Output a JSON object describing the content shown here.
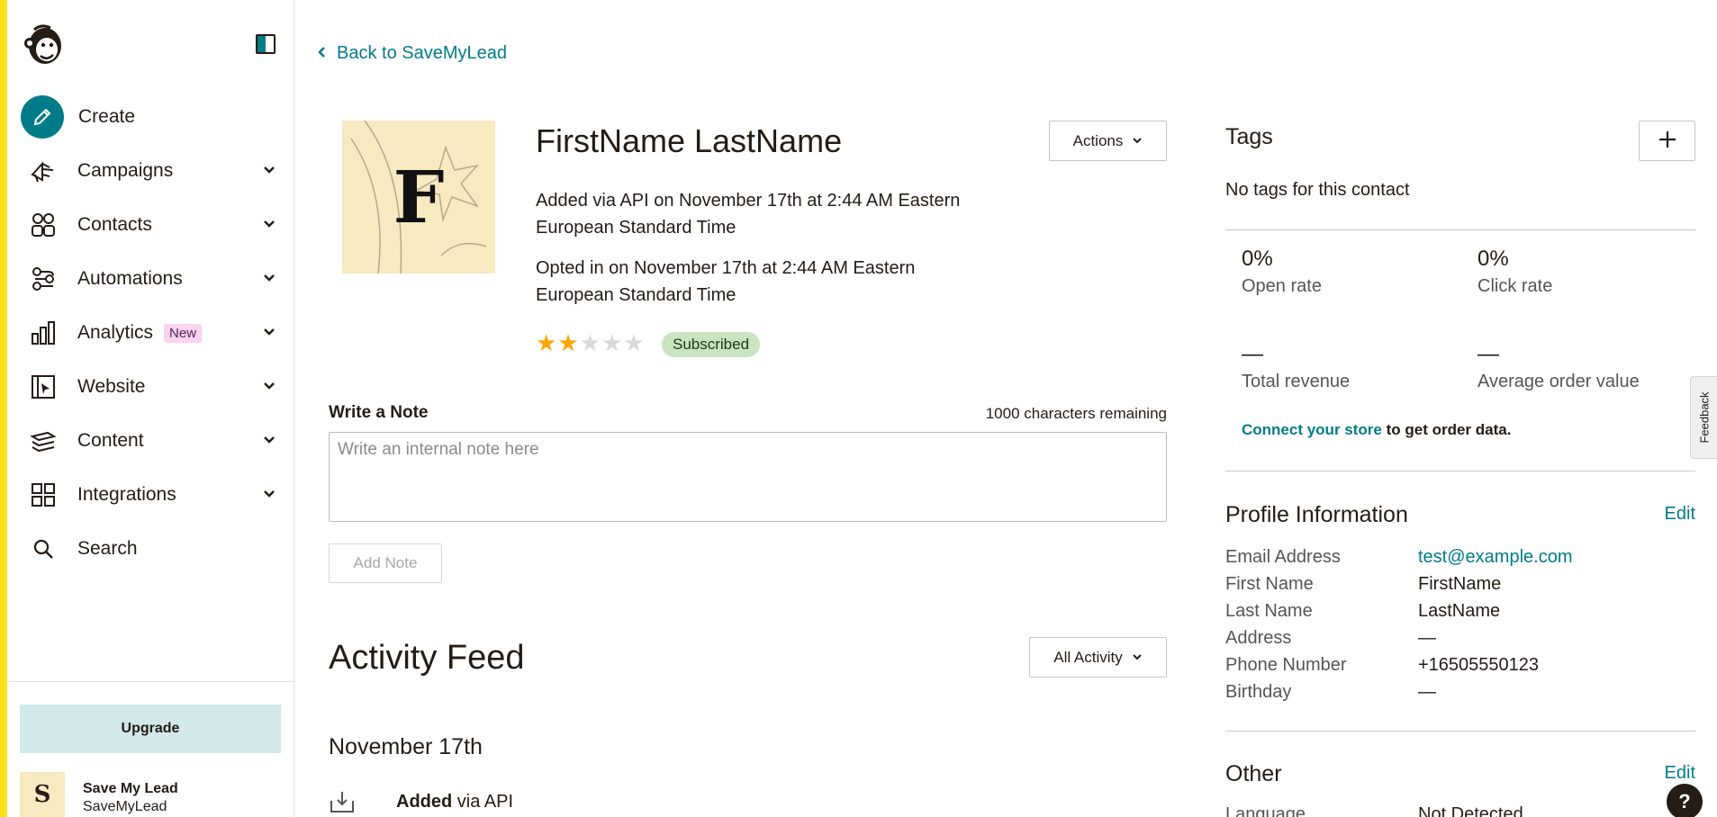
{
  "sidebar": {
    "create_label": "Create",
    "items": [
      {
        "label": "Campaigns",
        "icon": "megaphone-icon"
      },
      {
        "label": "Contacts",
        "icon": "contacts-icon"
      },
      {
        "label": "Automations",
        "icon": "automation-icon"
      },
      {
        "label": "Analytics",
        "icon": "bar-chart-icon",
        "badge": "New"
      },
      {
        "label": "Website",
        "icon": "website-icon"
      },
      {
        "label": "Content",
        "icon": "content-icon"
      },
      {
        "label": "Integrations",
        "icon": "grid-icon"
      },
      {
        "label": "Search",
        "icon": "search-icon"
      }
    ],
    "upgrade_label": "Upgrade",
    "account": {
      "avatar_letter": "S",
      "name": "Save My Lead",
      "org": "SaveMyLead"
    }
  },
  "main": {
    "back_link": "Back to SaveMyLead",
    "contact": {
      "avatar_letter": "F",
      "name": "FirstName LastName",
      "added_line1": "Added via API on November 17th at 2:44 AM Eastern",
      "added_line2": "European Standard Time",
      "opted_line1": "Opted in on November 17th at 2:44 AM Eastern",
      "opted_line2": "European Standard Time",
      "rating": 2,
      "rating_max": 5,
      "status": "Subscribed"
    },
    "actions_label": "Actions",
    "note": {
      "title": "Write a Note",
      "remaining": "1000 characters remaining",
      "placeholder": "Write an internal note here",
      "add_label": "Add Note"
    },
    "feed": {
      "title": "Activity Feed",
      "filter_label": "All Activity",
      "date": "November 17th",
      "entry_bold": "Added",
      "entry_rest": "via API"
    }
  },
  "right": {
    "tags_title": "Tags",
    "tags_empty": "No tags for this contact",
    "stats": {
      "open_value": "0%",
      "open_label": "Open rate",
      "click_value": "0%",
      "click_label": "Click rate",
      "revenue_value": "—",
      "revenue_label": "Total revenue",
      "aov_value": "—",
      "aov_label": "Average order value"
    },
    "store_link": "Connect your store",
    "store_rest": "to get order data.",
    "profile": {
      "title": "Profile Information",
      "edit_label": "Edit",
      "rows": [
        {
          "label": "Email Address",
          "value": "test@example.com"
        },
        {
          "label": "First Name",
          "value": "FirstName"
        },
        {
          "label": "Last Name",
          "value": "LastName"
        },
        {
          "label": "Address",
          "value": "—"
        },
        {
          "label": "Phone Number",
          "value": "+16505550123"
        },
        {
          "label": "Birthday",
          "value": "—"
        }
      ]
    },
    "other": {
      "title": "Other",
      "edit_label": "Edit",
      "language_label": "Language",
      "language_value": "Not Detected"
    }
  },
  "feedback_label": "Feedback",
  "help_label": "?",
  "colors": {
    "accent": "#007c89",
    "brand_yellow": "#ffe01b",
    "upgrade_bg": "#d2e8ea",
    "badge_new": "#f9d3ef",
    "subscribed": "#c8e4c1"
  }
}
